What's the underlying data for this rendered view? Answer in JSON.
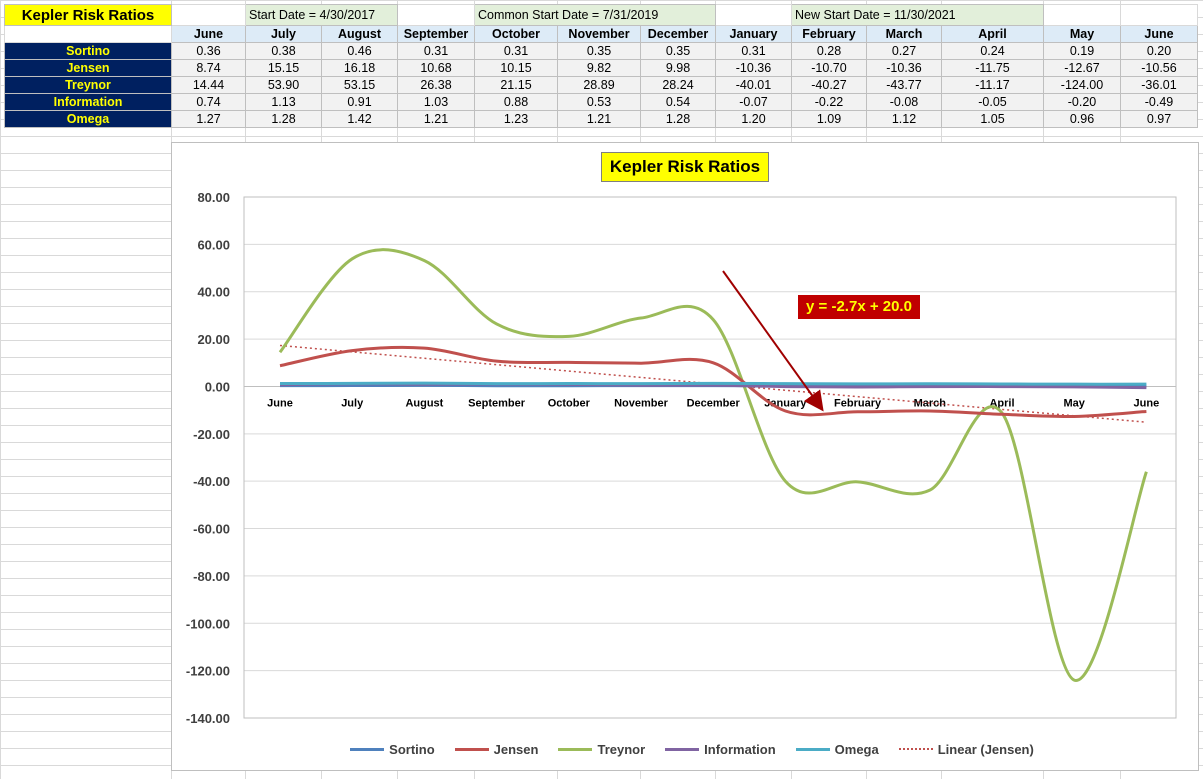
{
  "sheet": {
    "title": "Kepler Risk Ratios",
    "start_date": "Start Date = 4/30/2017",
    "common_start_date": "Common Start Date = 7/31/2019",
    "new_start_date": "New Start Date = 11/30/2021",
    "months": [
      "June",
      "July",
      "August",
      "September",
      "October",
      "November",
      "December",
      "January",
      "February",
      "March",
      "April",
      "May",
      "June"
    ],
    "rows": [
      {
        "label": "Sortino",
        "values": [
          "0.36",
          "0.38",
          "0.46",
          "0.31",
          "0.31",
          "0.35",
          "0.35",
          "0.31",
          "0.28",
          "0.27",
          "0.24",
          "0.19",
          "0.20"
        ]
      },
      {
        "label": "Jensen",
        "values": [
          "8.74",
          "15.15",
          "16.18",
          "10.68",
          "10.15",
          "9.82",
          "9.98",
          "-10.36",
          "-10.70",
          "-10.36",
          "-11.75",
          "-12.67",
          "-10.56"
        ]
      },
      {
        "label": "Treynor",
        "values": [
          "14.44",
          "53.90",
          "53.15",
          "26.38",
          "21.15",
          "28.89",
          "28.24",
          "-40.01",
          "-40.27",
          "-43.77",
          "-11.17",
          "-124.00",
          "-36.01"
        ]
      },
      {
        "label": "Information",
        "values": [
          "0.74",
          "1.13",
          "0.91",
          "1.03",
          "0.88",
          "0.53",
          "0.54",
          "-0.07",
          "-0.22",
          "-0.08",
          "-0.05",
          "-0.20",
          "-0.49"
        ]
      },
      {
        "label": "Omega",
        "values": [
          "1.27",
          "1.28",
          "1.42",
          "1.21",
          "1.23",
          "1.21",
          "1.28",
          "1.20",
          "1.09",
          "1.12",
          "1.05",
          "0.96",
          "0.97"
        ]
      }
    ]
  },
  "chart_data": {
    "type": "line",
    "title": "Kepler Risk Ratios",
    "categories": [
      "June",
      "July",
      "August",
      "September",
      "October",
      "November",
      "December",
      "January",
      "February",
      "March",
      "April",
      "May",
      "June"
    ],
    "ylim": [
      -140,
      80
    ],
    "yticks": [
      80,
      60,
      40,
      20,
      0,
      -20,
      -40,
      -60,
      -80,
      -100,
      -120,
      -140
    ],
    "ytick_labels": [
      "80.00",
      "60.00",
      "40.00",
      "20.00",
      "0.00",
      "-20.00",
      "-40.00",
      "-60.00",
      "-80.00",
      "-100.00",
      "-120.00",
      "-140.00"
    ],
    "grid": true,
    "legend_position": "bottom",
    "series": [
      {
        "name": "Sortino",
        "color": "#4f81bd",
        "values": [
          0.36,
          0.38,
          0.46,
          0.31,
          0.31,
          0.35,
          0.35,
          0.31,
          0.28,
          0.27,
          0.24,
          0.19,
          0.2
        ]
      },
      {
        "name": "Jensen",
        "color": "#c0504d",
        "values": [
          8.74,
          15.15,
          16.18,
          10.68,
          10.15,
          9.82,
          9.98,
          -10.36,
          -10.7,
          -10.36,
          -11.75,
          -12.67,
          -10.56
        ]
      },
      {
        "name": "Treynor",
        "color": "#9bbb59",
        "values": [
          14.44,
          53.9,
          53.15,
          26.38,
          21.15,
          28.89,
          28.24,
          -40.01,
          -40.27,
          -43.77,
          -11.17,
          -124.0,
          -36.01
        ]
      },
      {
        "name": "Information",
        "color": "#8064a2",
        "values": [
          0.74,
          1.13,
          0.91,
          1.03,
          0.88,
          0.53,
          0.54,
          -0.07,
          -0.22,
          -0.08,
          -0.05,
          -0.2,
          -0.49
        ]
      },
      {
        "name": "Omega",
        "color": "#4bacc6",
        "values": [
          1.27,
          1.28,
          1.42,
          1.21,
          1.23,
          1.21,
          1.28,
          1.2,
          1.09,
          1.12,
          1.05,
          0.96,
          0.97
        ]
      }
    ],
    "trendline": {
      "name": "Linear (Jensen)",
      "of_series": "Jensen",
      "color": "#c0504d",
      "equation": "y = -2.7x + 20.0",
      "slope": -2.7,
      "intercept": 20.0
    },
    "annotation": {
      "type": "arrow",
      "color": "#a00000"
    }
  }
}
